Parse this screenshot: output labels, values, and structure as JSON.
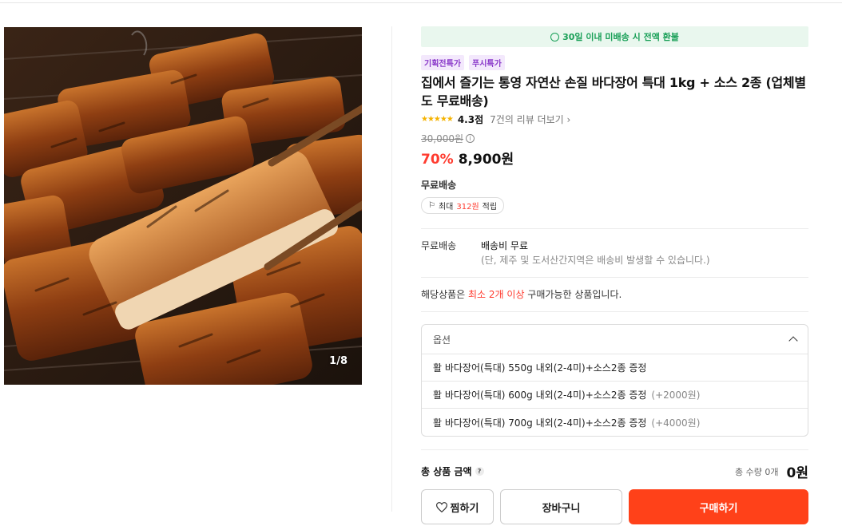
{
  "gallery": {
    "pager": "1/8"
  },
  "refund_banner": {
    "text": "30일 이내 미배송 시 전액 환불",
    "icon": "coin-icon",
    "color": "#1aa058"
  },
  "badges": [
    "기획전특가",
    "푸시특가"
  ],
  "product": {
    "title": "집에서 즐기는 통영 자연산 손질 바다장어 특대 1kg + 소스 2종 (업체별도 무료배송)",
    "rating": 4.3,
    "rating_text": "4.3점",
    "review_link": "7건의 리뷰 더보기",
    "original_price": "30,000원",
    "discount": "70%",
    "price": "8,900원"
  },
  "shipping": {
    "title": "무료배송",
    "point_prefix": "최대 ",
    "point_amount": "312원",
    "point_suffix": " 적립",
    "label": "무료배송",
    "fee": "배송비 무료",
    "note": "(단, 제주 및 도서산간지역은 배송비 발생할 수 있습니다.)"
  },
  "notice": {
    "prefix": "해당상품은 ",
    "highlight": "최소 2개 이상",
    "suffix": " 구매가능한 상품입니다."
  },
  "options": {
    "header": "옵션",
    "items": [
      {
        "name": "활 바다장어(특대) 550g 내외(2-4미)+소스2종 증정",
        "extra": ""
      },
      {
        "name": "활 바다장어(특대) 600g 내외(2-4미)+소스2종 증정",
        "extra": "(+2000원)"
      },
      {
        "name": "활 바다장어(특대) 700g 내외(2-4미)+소스2종 증정",
        "extra": "(+4000원)"
      }
    ]
  },
  "total": {
    "label": "총 상품 금액",
    "qty": "총 수량 0개",
    "amount": "0원"
  },
  "buttons": {
    "wish": "찜하기",
    "cart": "장바구니",
    "buy": "구매하기"
  },
  "colors": {
    "accent": "#ff4119",
    "discount": "#ff3b2f",
    "badge": "#8a39c9"
  }
}
